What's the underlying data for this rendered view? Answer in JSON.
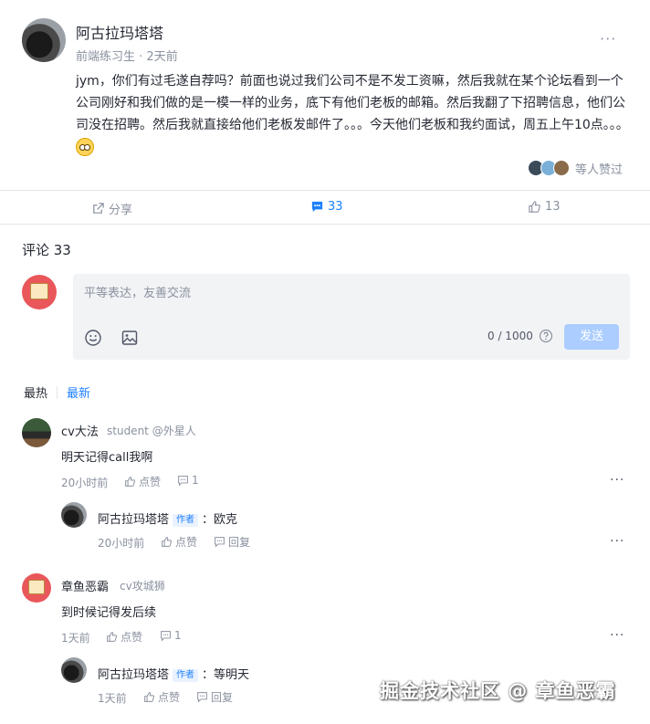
{
  "post": {
    "author": "阿古拉玛塔塔",
    "role": "前端练习生",
    "time": "2天前",
    "more": "···",
    "body": "jym，你们有过毛遂自荐吗？前面也说过我们公司不是不发工资嘛，然后我就在某个论坛看到一个公司刚好和我们做的是一模一样的业务，底下有他们老板的邮箱。然后我翻了下招聘信息，他们公司没在招聘。然后我就直接给他们老板发邮件了。。。今天他们老板和我约面试，周五上午10点。。。",
    "likers_text": "等人赞过"
  },
  "actions": {
    "share": "分享",
    "comment_count": "33",
    "like_count": "13"
  },
  "comments_header": "评论 33",
  "editor": {
    "placeholder": "平等表达，友善交流",
    "counter": "0 / 1000",
    "send": "发送"
  },
  "sort": {
    "hot": "最热",
    "new": "最新"
  },
  "comments": [
    {
      "name": "cv大法",
      "role": "student @外星人",
      "text": "明天记得call我啊",
      "time": "20小时前",
      "like": "点赞",
      "reply_count": "1",
      "reply": {
        "name": "阿古拉玛塔塔",
        "badge": "作者",
        "text": "：欧克",
        "time": "20小时前",
        "like": "点赞",
        "reply": "回复"
      }
    },
    {
      "name": "章鱼恶霸",
      "role": "cv攻城狮",
      "text": "到时候记得发后续",
      "time": "1天前",
      "like": "点赞",
      "reply_count": "1",
      "reply": {
        "name": "阿古拉玛塔塔",
        "badge": "作者",
        "text": "：等明天",
        "time": "1天前",
        "like": "点赞",
        "reply": "回复"
      }
    }
  ],
  "more": "···",
  "watermark": "掘金技术社区 @ 章鱼恶霸",
  "colors": {
    "accent": "#1e80ff",
    "send_disabled": "#abcdff",
    "avatar_red": "#e9575a"
  }
}
